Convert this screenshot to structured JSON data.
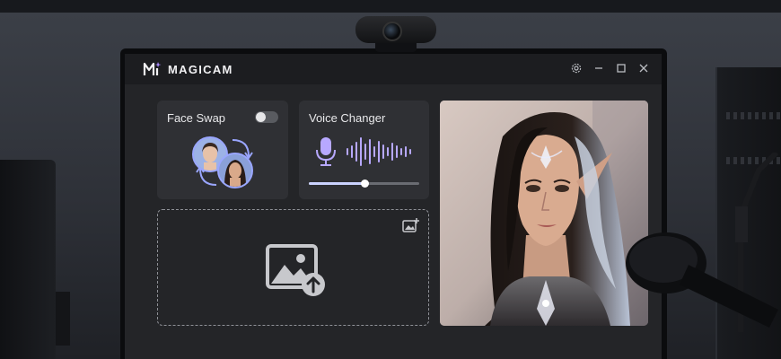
{
  "app": {
    "name": "MAGICAM"
  },
  "face_swap": {
    "title": "Face Swap",
    "toggle_on": false
  },
  "voice_changer": {
    "title": "Voice Changer",
    "slider_value": 0.5
  },
  "colors": {
    "accent": "#9aa6ff",
    "wave": "#b7a8ff",
    "background": "#242528",
    "card": "#2f3034"
  },
  "icons": {
    "settings": "gear-icon",
    "minimize": "minimize-icon",
    "maximize": "maximize-icon",
    "close": "close-icon",
    "upload": "image-upload-icon",
    "add_image": "add-image-icon",
    "microphone": "microphone-icon"
  }
}
